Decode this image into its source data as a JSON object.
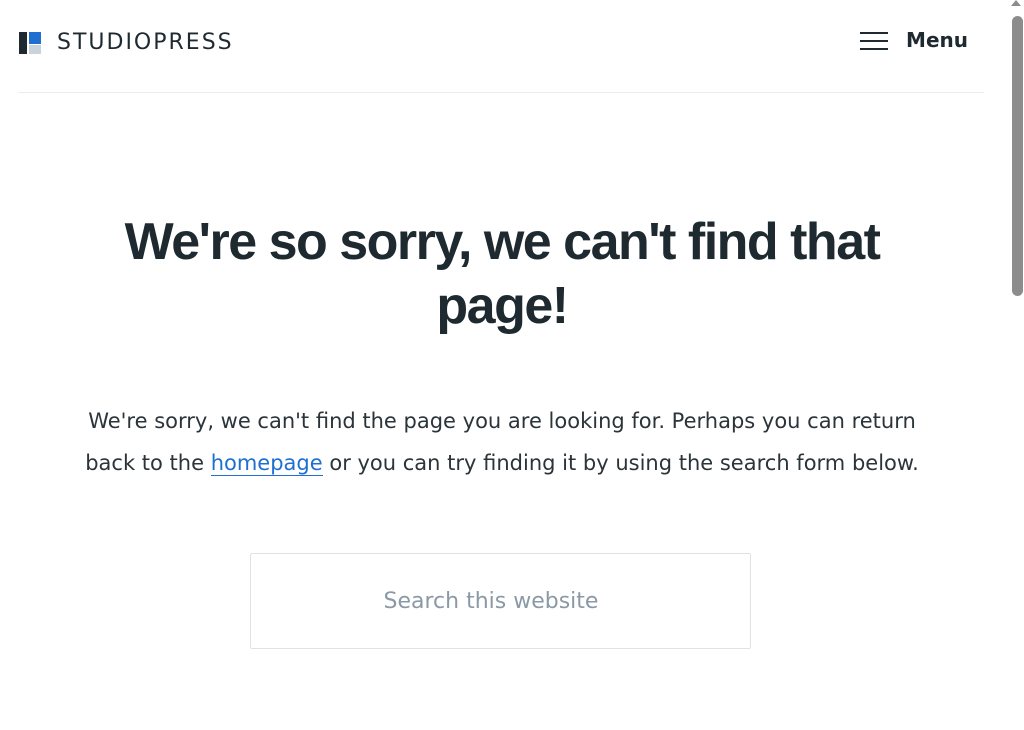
{
  "header": {
    "logo_text": "STUDIOPRESS",
    "menu_label": "Menu"
  },
  "main": {
    "headline": "We're so sorry, we can't find that page!",
    "message_before_link": "We're sorry, we can't find the page you are looking for. Perhaps you can return back to the ",
    "link_text": "homepage",
    "message_after_link": " or you can try finding it by using the search form below."
  },
  "search": {
    "placeholder": "Search this website",
    "value": ""
  },
  "colors": {
    "text": "#1e2a30",
    "link": "#1f6fd1",
    "placeholder": "#8a99a5",
    "logo_accent": "#1f6fd1"
  },
  "icons": {
    "logo": "studiopress-logo-icon",
    "menu": "hamburger-menu-icon"
  }
}
